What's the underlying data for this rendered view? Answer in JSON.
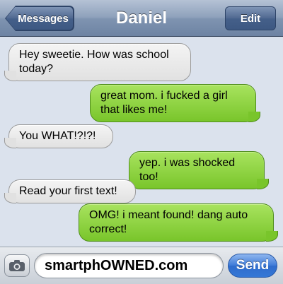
{
  "header": {
    "back_label": "Messages",
    "title": "Daniel",
    "edit_label": "Edit"
  },
  "messages": [
    {
      "direction": "received",
      "text": "Hey sweetie. How was school today?"
    },
    {
      "direction": "sent",
      "text": "great mom. i fucked a girl that likes me!"
    },
    {
      "direction": "received",
      "text": "You WHAT!?!?!"
    },
    {
      "direction": "sent",
      "text": "yep. i was shocked too!"
    },
    {
      "direction": "received",
      "text": "Read your first text!"
    },
    {
      "direction": "sent",
      "text": "OMG! i meant found! dang auto correct!"
    }
  ],
  "composer": {
    "camera_icon": "camera-icon",
    "field_value": "smartphOWNED.com",
    "send_label": "Send"
  },
  "colors": {
    "nav_bar": "#8ea1bb",
    "background": "#dbe2ed",
    "received_bubble": "#e6e6e6",
    "sent_bubble": "#8fd444",
    "send_button": "#3e7bd8"
  }
}
